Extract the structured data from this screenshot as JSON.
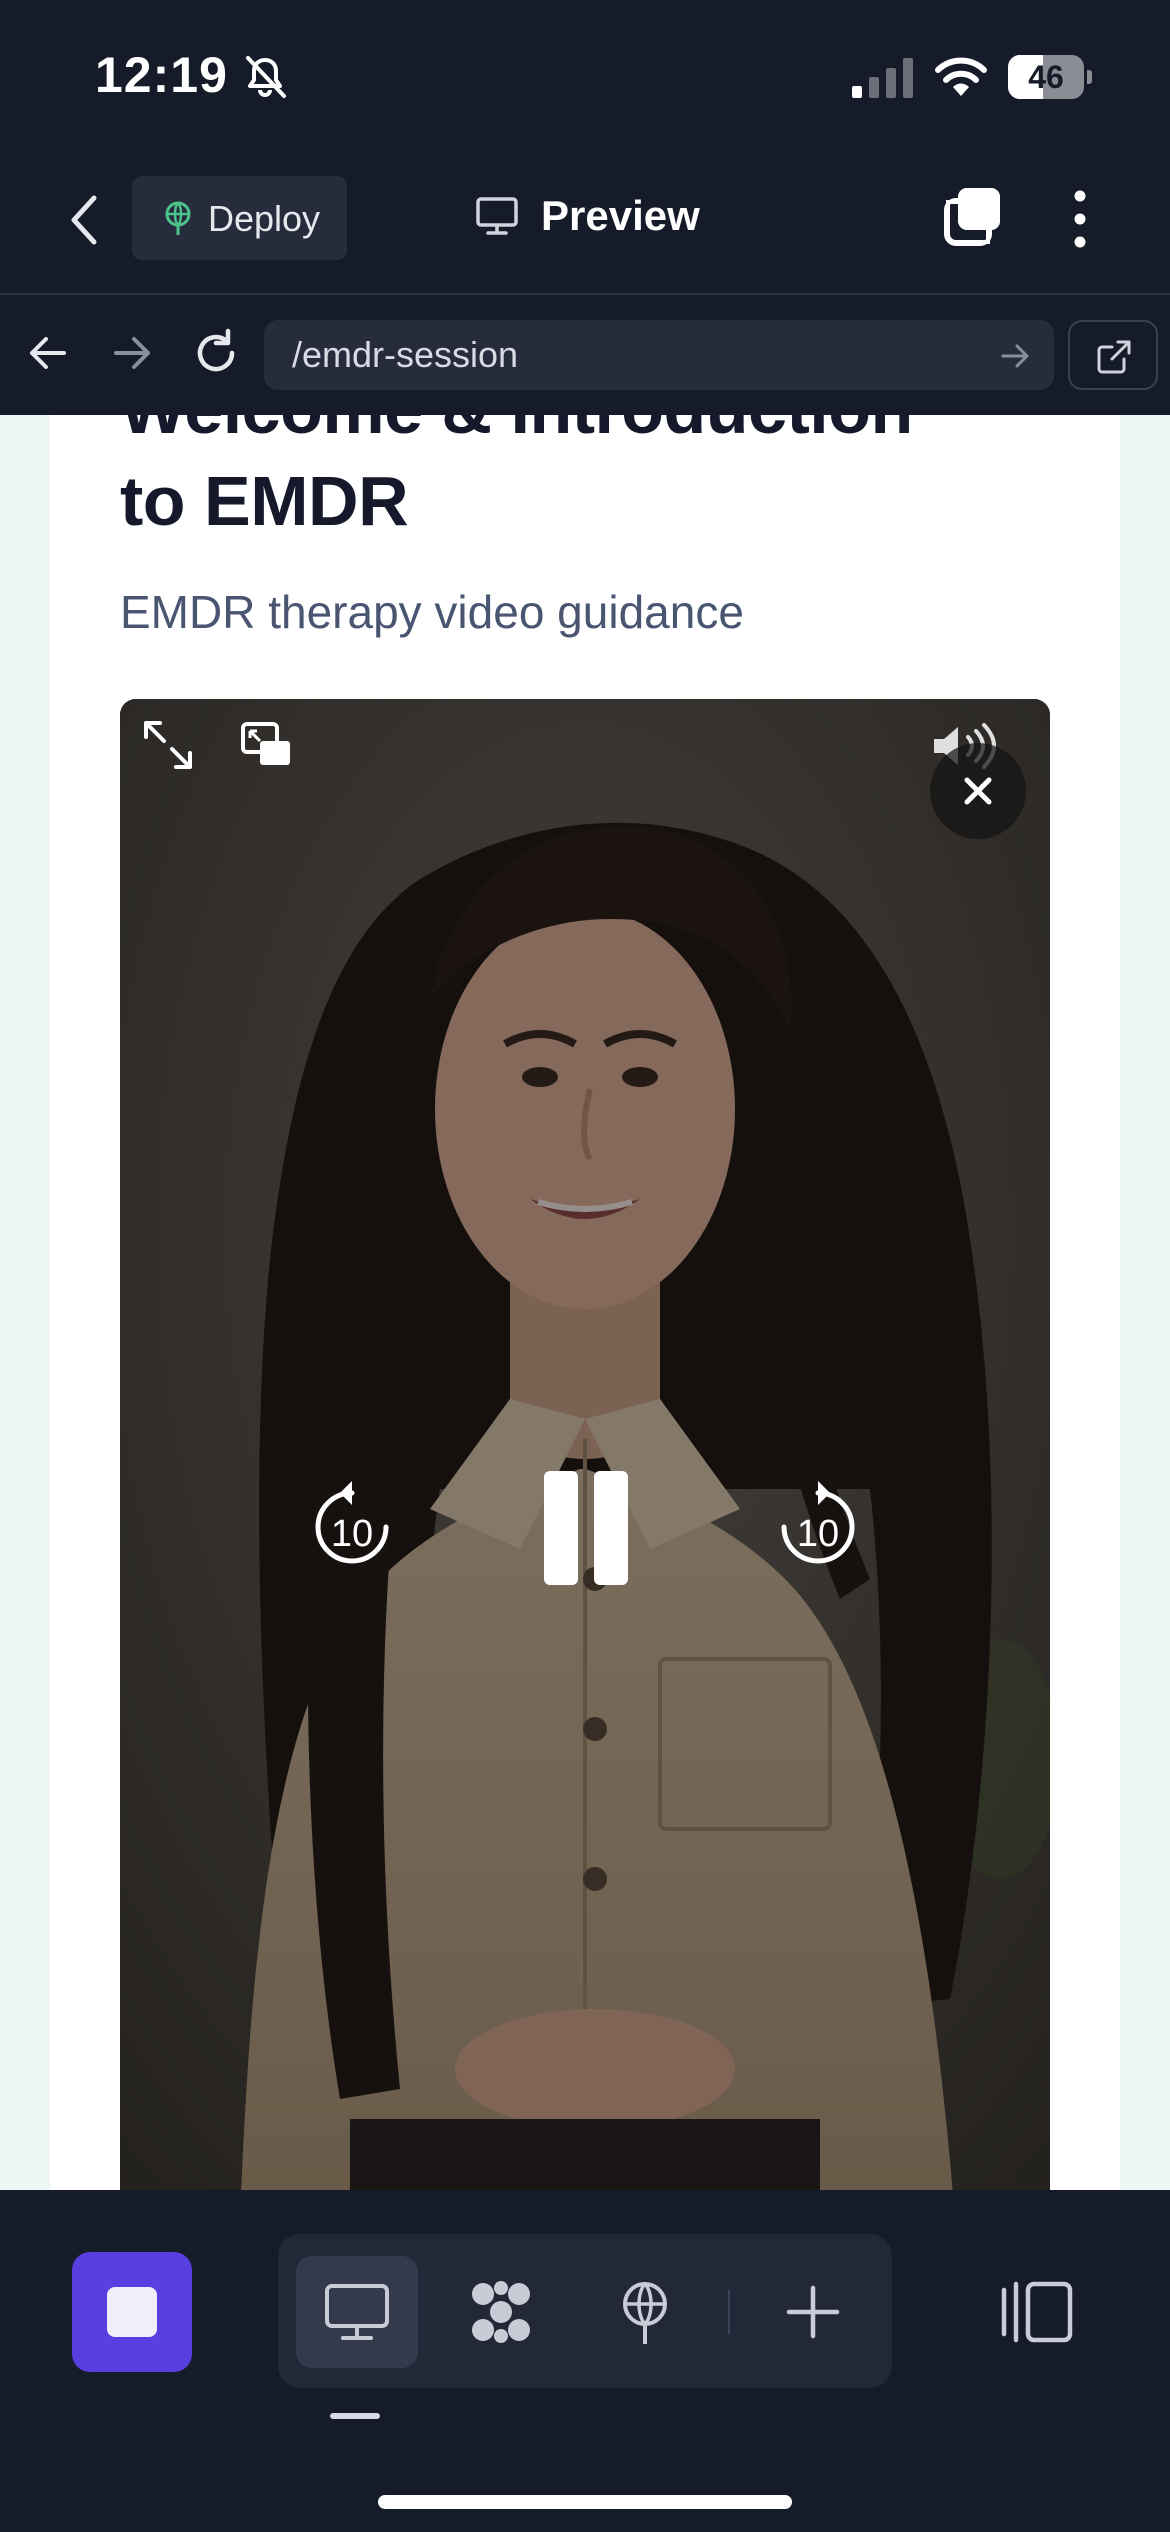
{
  "status_bar": {
    "time": "12:19",
    "battery": "46",
    "battery_level": 0.46
  },
  "toolbar": {
    "deploy_label": "Deploy",
    "preview_label": "Preview"
  },
  "browser": {
    "url": "/emdr-session"
  },
  "page": {
    "title_clipped": "Welcome & Introduction",
    "title_line2": "to EMDR",
    "subtitle": "EMDR therapy video guidance"
  },
  "video": {
    "rewind_seconds": "10",
    "forward_seconds": "10",
    "state": "playing"
  },
  "bottom_bar": {
    "tools": [
      "preview-tool",
      "workspace-tool",
      "deploy-tool",
      "add-tool"
    ],
    "active_tool": "preview-tool"
  },
  "colors": {
    "app_bg": "#161b29",
    "accent": "#5a3fe0",
    "deploy_icon": "#4cc38a",
    "page_bg": "#eef7f3",
    "heading": "#15192b"
  }
}
